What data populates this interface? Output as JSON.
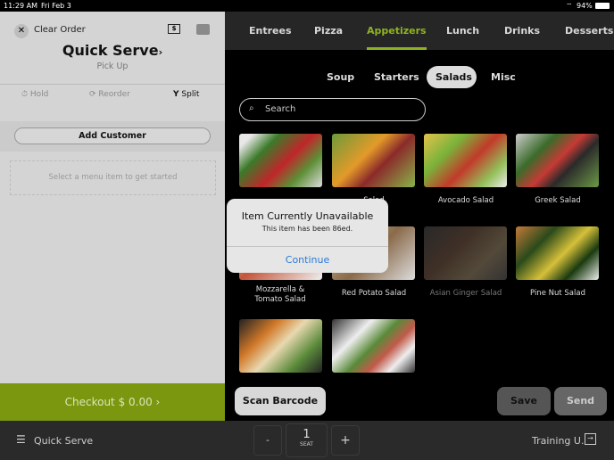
{
  "status": {
    "time": "11:29 AM",
    "date": "Fri Feb 3",
    "battery": "94%"
  },
  "order": {
    "clear_label": "Clear Order",
    "title": "Quick Serve",
    "chevron": "›",
    "subtitle": "Pick Up",
    "hold": "Hold",
    "reorder": "Reorder",
    "split": "Split",
    "add_customer": "Add Customer",
    "empty_hint": "Select a menu item to get started",
    "checkout": "Checkout $ 0.00 ›"
  },
  "categories": [
    {
      "label": "Entrees"
    },
    {
      "label": "Pizza"
    },
    {
      "label": "Appetizers",
      "active": true
    },
    {
      "label": "Lunch"
    },
    {
      "label": "Drinks"
    },
    {
      "label": "Desserts"
    }
  ],
  "subcategories": [
    {
      "label": "Soup"
    },
    {
      "label": "Starters"
    },
    {
      "label": "Salads",
      "active": true
    },
    {
      "label": "Misc"
    }
  ],
  "search": {
    "placeholder": "Search"
  },
  "items": [
    {
      "name": ""
    },
    {
      "name": "Salad"
    },
    {
      "name": "Avocado Salad"
    },
    {
      "name": "Greek Salad"
    },
    {
      "name": "Mozzarella & Tomato Salad"
    },
    {
      "name": "Red Potato Salad"
    },
    {
      "name": "Asian Ginger Salad",
      "unavailable": true
    },
    {
      "name": "Pine Nut Salad"
    },
    {
      "name": ""
    },
    {
      "name": ""
    }
  ],
  "actions": {
    "scan": "Scan Barcode",
    "save": "Save",
    "send": "Send"
  },
  "bottom": {
    "menu": "Quick Serve",
    "minus": "-",
    "seat_num": "1",
    "seat_label": "SEAT",
    "plus": "+",
    "user": "Training U."
  },
  "modal": {
    "title": "Item Currently Unavailable",
    "message": "This item has been 86ed.",
    "button": "Continue"
  },
  "colors": {
    "accent": "#8fb320",
    "checkout": "#7a970f",
    "link": "#2a7bd6"
  }
}
